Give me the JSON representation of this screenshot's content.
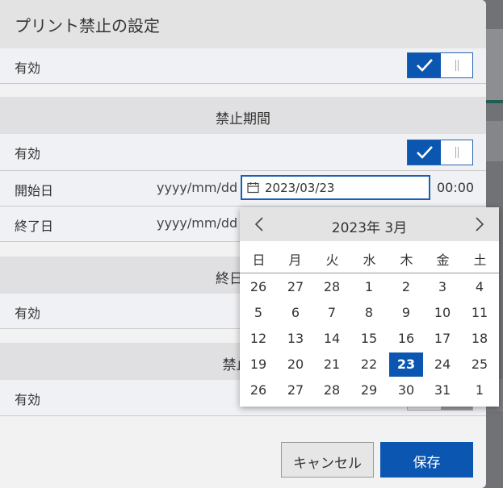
{
  "dialog": {
    "title": "プリント禁止の設定"
  },
  "rows": {
    "enable_main": {
      "label": "有効"
    },
    "section_period": {
      "label": "禁止期間"
    },
    "enable_period": {
      "label": "有効"
    },
    "start": {
      "label": "開始日",
      "format": "yyyy/mm/dd",
      "value": "2023/03/23",
      "time": "00:00"
    },
    "end": {
      "label": "終了日",
      "format": "yyyy/mm/dd"
    },
    "section_allday": {
      "label": "終日禁止"
    },
    "enable_allday": {
      "label": "有効"
    },
    "section_time": {
      "label": "禁止時"
    },
    "enable_time": {
      "label": "有効"
    }
  },
  "calendar": {
    "title": "2023年 3月",
    "weekdays": [
      "日",
      "月",
      "火",
      "水",
      "木",
      "金",
      "土"
    ],
    "weeks": [
      [
        "26",
        "27",
        "28",
        "1",
        "2",
        "3",
        "4"
      ],
      [
        "5",
        "6",
        "7",
        "8",
        "9",
        "10",
        "11"
      ],
      [
        "12",
        "13",
        "14",
        "15",
        "16",
        "17",
        "18"
      ],
      [
        "19",
        "20",
        "21",
        "22",
        "23",
        "24",
        "25"
      ],
      [
        "26",
        "27",
        "28",
        "29",
        "30",
        "31",
        "1"
      ]
    ],
    "selected": "23",
    "prev_icon": "chevron-left-icon",
    "next_icon": "chevron-right-icon"
  },
  "buttons": {
    "cancel": "キャンセル",
    "save": "保存"
  },
  "colors": {
    "accent": "#0a56b0",
    "header": "#e3e3e3"
  }
}
